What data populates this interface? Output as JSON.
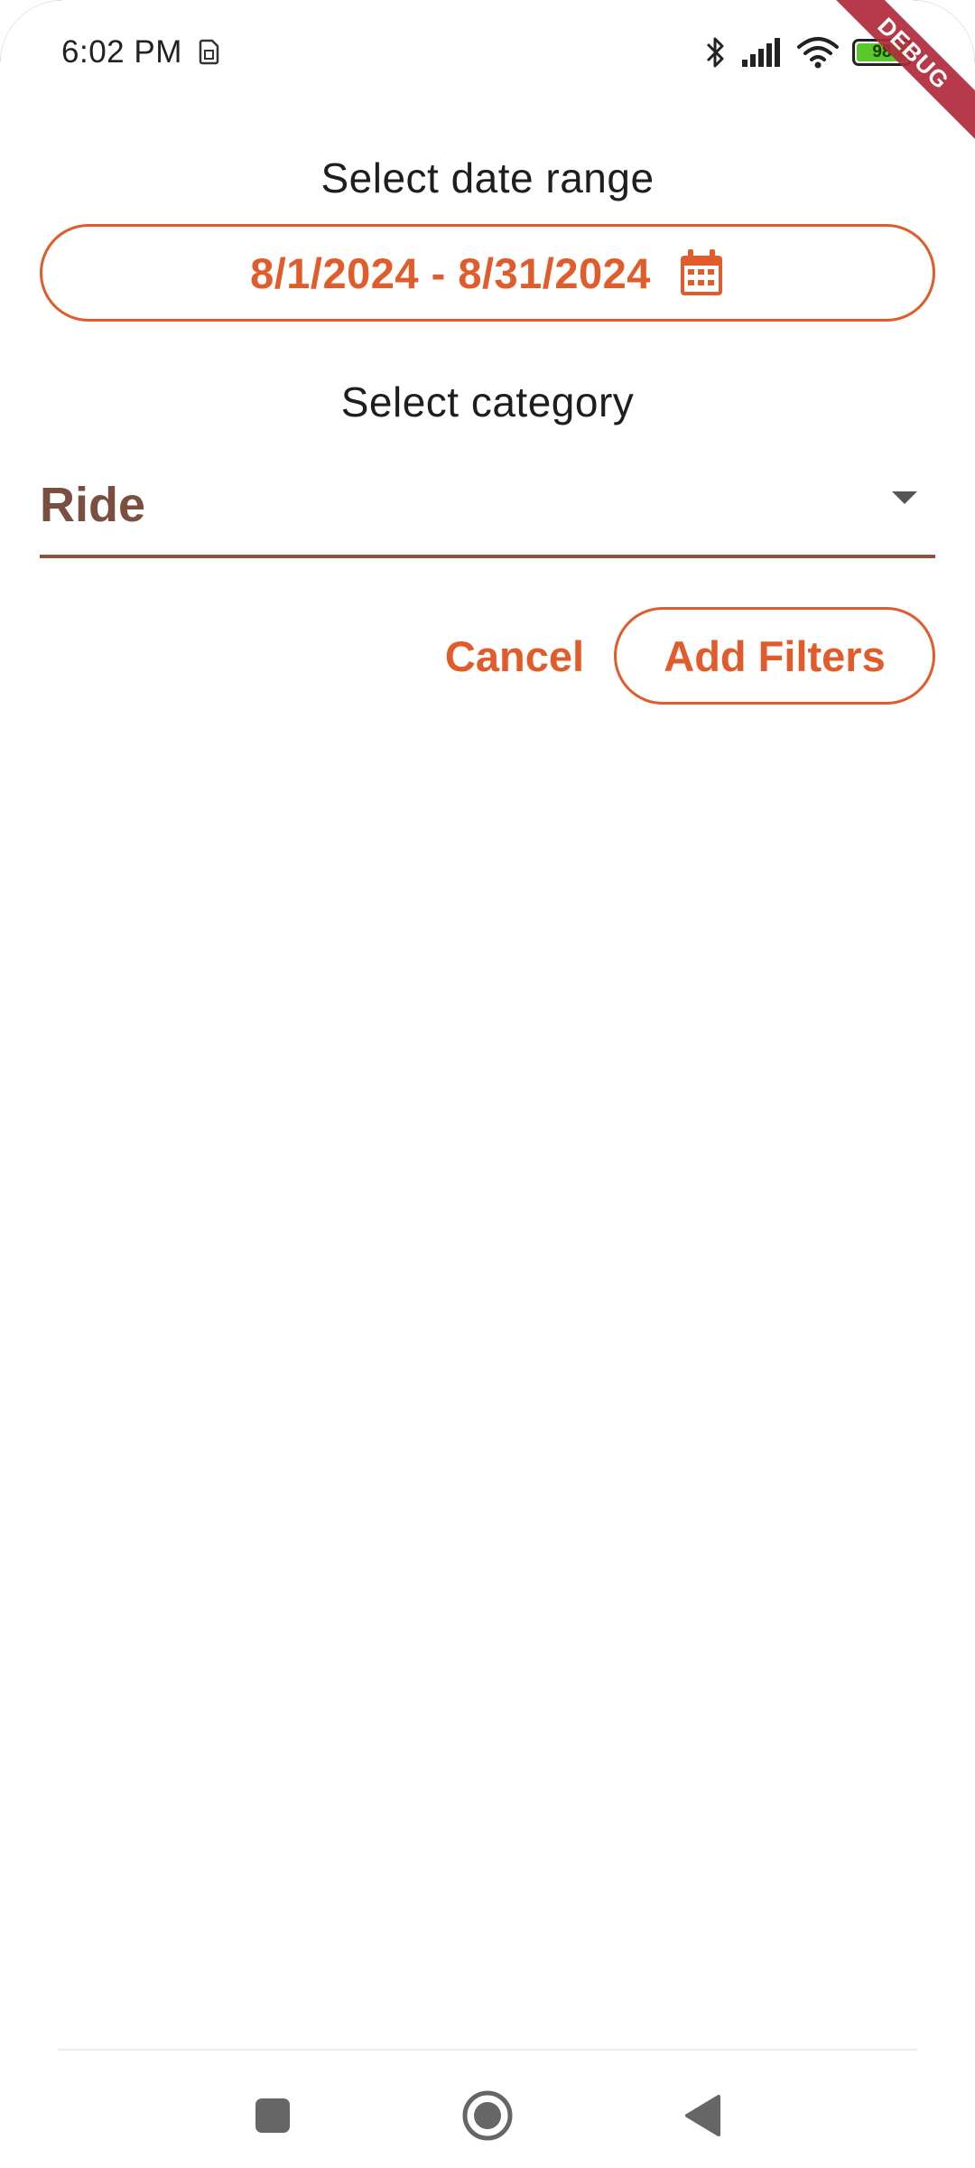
{
  "status_bar": {
    "time": "6:02 PM",
    "battery_level": "98",
    "battery_percent": 98,
    "icons": [
      "sim-icon",
      "bluetooth-icon",
      "signal-icon",
      "wifi-icon",
      "battery-icon"
    ]
  },
  "debug_banner": {
    "label": "DEBUG"
  },
  "date_range": {
    "label": "Select date range",
    "value": "8/1/2024 - 8/31/2024",
    "icon": "calendar-icon"
  },
  "category": {
    "label": "Select category",
    "value": "Ride",
    "icon": "dropdown-arrow-icon"
  },
  "actions": {
    "cancel_label": "Cancel",
    "add_filters_label": "Add Filters"
  },
  "nav_bar": {
    "icons": [
      "recents-icon",
      "home-icon",
      "back-icon"
    ]
  },
  "colors": {
    "accent": "#e25c2b",
    "dropdown_text": "#7a4f3f",
    "dropdown_underline": "#8a5340",
    "debug_banner": "#b02a3a",
    "battery_fill": "#59c92a"
  }
}
